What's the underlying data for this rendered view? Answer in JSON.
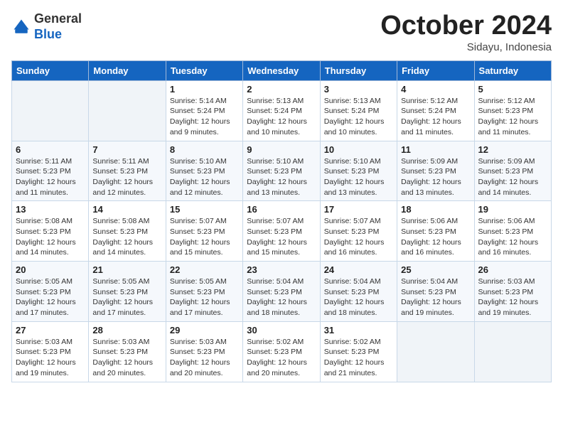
{
  "logo": {
    "general": "General",
    "blue": "Blue"
  },
  "header": {
    "month": "October 2024",
    "location": "Sidayu, Indonesia"
  },
  "weekdays": [
    "Sunday",
    "Monday",
    "Tuesday",
    "Wednesday",
    "Thursday",
    "Friday",
    "Saturday"
  ],
  "weeks": [
    [
      {
        "day": "",
        "info": ""
      },
      {
        "day": "",
        "info": ""
      },
      {
        "day": "1",
        "info": "Sunrise: 5:14 AM\nSunset: 5:24 PM\nDaylight: 12 hours\nand 9 minutes."
      },
      {
        "day": "2",
        "info": "Sunrise: 5:13 AM\nSunset: 5:24 PM\nDaylight: 12 hours\nand 10 minutes."
      },
      {
        "day": "3",
        "info": "Sunrise: 5:13 AM\nSunset: 5:24 PM\nDaylight: 12 hours\nand 10 minutes."
      },
      {
        "day": "4",
        "info": "Sunrise: 5:12 AM\nSunset: 5:24 PM\nDaylight: 12 hours\nand 11 minutes."
      },
      {
        "day": "5",
        "info": "Sunrise: 5:12 AM\nSunset: 5:23 PM\nDaylight: 12 hours\nand 11 minutes."
      }
    ],
    [
      {
        "day": "6",
        "info": "Sunrise: 5:11 AM\nSunset: 5:23 PM\nDaylight: 12 hours\nand 11 minutes."
      },
      {
        "day": "7",
        "info": "Sunrise: 5:11 AM\nSunset: 5:23 PM\nDaylight: 12 hours\nand 12 minutes."
      },
      {
        "day": "8",
        "info": "Sunrise: 5:10 AM\nSunset: 5:23 PM\nDaylight: 12 hours\nand 12 minutes."
      },
      {
        "day": "9",
        "info": "Sunrise: 5:10 AM\nSunset: 5:23 PM\nDaylight: 12 hours\nand 13 minutes."
      },
      {
        "day": "10",
        "info": "Sunrise: 5:10 AM\nSunset: 5:23 PM\nDaylight: 12 hours\nand 13 minutes."
      },
      {
        "day": "11",
        "info": "Sunrise: 5:09 AM\nSunset: 5:23 PM\nDaylight: 12 hours\nand 13 minutes."
      },
      {
        "day": "12",
        "info": "Sunrise: 5:09 AM\nSunset: 5:23 PM\nDaylight: 12 hours\nand 14 minutes."
      }
    ],
    [
      {
        "day": "13",
        "info": "Sunrise: 5:08 AM\nSunset: 5:23 PM\nDaylight: 12 hours\nand 14 minutes."
      },
      {
        "day": "14",
        "info": "Sunrise: 5:08 AM\nSunset: 5:23 PM\nDaylight: 12 hours\nand 14 minutes."
      },
      {
        "day": "15",
        "info": "Sunrise: 5:07 AM\nSunset: 5:23 PM\nDaylight: 12 hours\nand 15 minutes."
      },
      {
        "day": "16",
        "info": "Sunrise: 5:07 AM\nSunset: 5:23 PM\nDaylight: 12 hours\nand 15 minutes."
      },
      {
        "day": "17",
        "info": "Sunrise: 5:07 AM\nSunset: 5:23 PM\nDaylight: 12 hours\nand 16 minutes."
      },
      {
        "day": "18",
        "info": "Sunrise: 5:06 AM\nSunset: 5:23 PM\nDaylight: 12 hours\nand 16 minutes."
      },
      {
        "day": "19",
        "info": "Sunrise: 5:06 AM\nSunset: 5:23 PM\nDaylight: 12 hours\nand 16 minutes."
      }
    ],
    [
      {
        "day": "20",
        "info": "Sunrise: 5:05 AM\nSunset: 5:23 PM\nDaylight: 12 hours\nand 17 minutes."
      },
      {
        "day": "21",
        "info": "Sunrise: 5:05 AM\nSunset: 5:23 PM\nDaylight: 12 hours\nand 17 minutes."
      },
      {
        "day": "22",
        "info": "Sunrise: 5:05 AM\nSunset: 5:23 PM\nDaylight: 12 hours\nand 17 minutes."
      },
      {
        "day": "23",
        "info": "Sunrise: 5:04 AM\nSunset: 5:23 PM\nDaylight: 12 hours\nand 18 minutes."
      },
      {
        "day": "24",
        "info": "Sunrise: 5:04 AM\nSunset: 5:23 PM\nDaylight: 12 hours\nand 18 minutes."
      },
      {
        "day": "25",
        "info": "Sunrise: 5:04 AM\nSunset: 5:23 PM\nDaylight: 12 hours\nand 19 minutes."
      },
      {
        "day": "26",
        "info": "Sunrise: 5:03 AM\nSunset: 5:23 PM\nDaylight: 12 hours\nand 19 minutes."
      }
    ],
    [
      {
        "day": "27",
        "info": "Sunrise: 5:03 AM\nSunset: 5:23 PM\nDaylight: 12 hours\nand 19 minutes."
      },
      {
        "day": "28",
        "info": "Sunrise: 5:03 AM\nSunset: 5:23 PM\nDaylight: 12 hours\nand 20 minutes."
      },
      {
        "day": "29",
        "info": "Sunrise: 5:03 AM\nSunset: 5:23 PM\nDaylight: 12 hours\nand 20 minutes."
      },
      {
        "day": "30",
        "info": "Sunrise: 5:02 AM\nSunset: 5:23 PM\nDaylight: 12 hours\nand 20 minutes."
      },
      {
        "day": "31",
        "info": "Sunrise: 5:02 AM\nSunset: 5:23 PM\nDaylight: 12 hours\nand 21 minutes."
      },
      {
        "day": "",
        "info": ""
      },
      {
        "day": "",
        "info": ""
      }
    ]
  ]
}
